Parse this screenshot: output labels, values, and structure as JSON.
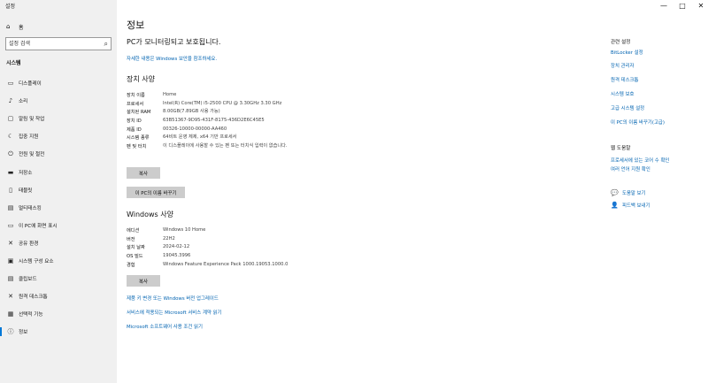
{
  "window": {
    "title": "설정",
    "controls": {
      "minimize": "—",
      "maximize": "□",
      "close": "✕"
    }
  },
  "sidebar": {
    "home": {
      "label": "홈",
      "icon": "home-icon"
    },
    "search": {
      "placeholder": "설정 검색",
      "icon": "search-icon"
    },
    "section": "시스템",
    "items": [
      {
        "label": "디스플레이",
        "icon": "display-icon",
        "glyph": "▭"
      },
      {
        "label": "소리",
        "icon": "speaker-icon",
        "glyph": "♪"
      },
      {
        "label": "알림 및 작업",
        "icon": "notification-icon",
        "glyph": "▢"
      },
      {
        "label": "집중 지원",
        "icon": "moon-icon",
        "glyph": "☾"
      },
      {
        "label": "전원 및 절전",
        "icon": "power-icon",
        "glyph": "⏻"
      },
      {
        "label": "저장소",
        "icon": "storage-icon",
        "glyph": "▬"
      },
      {
        "label": "태블릿",
        "icon": "tablet-icon",
        "glyph": "▯"
      },
      {
        "label": "멀티태스킹",
        "icon": "multitasking-icon",
        "glyph": "▤"
      },
      {
        "label": "이 PC에 화면 표시",
        "icon": "project-icon",
        "glyph": "▭"
      },
      {
        "label": "공유 환경",
        "icon": "share-icon",
        "glyph": "✕"
      },
      {
        "label": "시스템 구성 요소",
        "icon": "components-icon",
        "glyph": "▣"
      },
      {
        "label": "클립보드",
        "icon": "clipboard-icon",
        "glyph": "▤"
      },
      {
        "label": "원격 데스크톱",
        "icon": "remote-desktop-icon",
        "glyph": "✕"
      },
      {
        "label": "선택적 기능",
        "icon": "optional-features-icon",
        "glyph": "▦"
      },
      {
        "label": "정보",
        "icon": "info-icon",
        "glyph": "ⓘ"
      }
    ]
  },
  "main": {
    "title": "정보",
    "protection_status": "PC가 모니터링되고 보호됩니다.",
    "security_link": "자세한 내용은 Windows 보안을 참조하세요.",
    "device_specs": {
      "heading": "장치 사양",
      "rows": [
        {
          "k": "장치 이름",
          "v": "Home"
        },
        {
          "k": "프로세서",
          "v": "Intel(R) Core(TM) i5-2500 CPU @ 3.30GHz   3.30 GHz"
        },
        {
          "k": "설치된 RAM",
          "v": "8.00GB(7.89GB 사용 가능)"
        },
        {
          "k": "장치 ID",
          "v": "63B51367-9D95-431F-8175-436D2E6C45E5"
        },
        {
          "k": "제품 ID",
          "v": "00326-10000-00000-AA460"
        },
        {
          "k": "시스템 종류",
          "v": "64비트 운영 체제, x64 기반 프로세서"
        },
        {
          "k": "펜 및 터치",
          "v": "이 디스플레이에 사용할 수 있는 펜 또는 터치식 입력이 없습니다."
        }
      ],
      "copy_button": "복사",
      "rename_button": "이 PC의 이름 바꾸기"
    },
    "windows_specs": {
      "heading": "Windows 사양",
      "rows": [
        {
          "k": "에디션",
          "v": "Windows 10 Home"
        },
        {
          "k": "버전",
          "v": "22H2"
        },
        {
          "k": "설치 날짜",
          "v": "2024-02-12"
        },
        {
          "k": "OS 빌드",
          "v": "19045.3996"
        },
        {
          "k": "경험",
          "v": "Windows Feature Experience Pack 1000.19053.1000.0"
        }
      ],
      "copy_button": "복사"
    },
    "links": [
      "제품 키 변경 또는 Windows 버전 업그레이드",
      "서비스에 적용되는 Microsoft 서비스 계약 읽기",
      "Microsoft 소프트웨어 사용 조건 읽기"
    ]
  },
  "related": {
    "heading": "관련 설정",
    "links": [
      "BitLocker 설정",
      "장치 관리자",
      "원격 데스크톱",
      "시스템 보호",
      "고급 시스템 설정",
      "이 PC의 이름 바꾸기(고급)"
    ],
    "help_heading": "웹 도움말",
    "help_link": "프로세서에 있는 코어 수 확인",
    "help_link_line2": "여러 언어 지원 확인",
    "get_help": {
      "label": "도움말 보기",
      "icon": "chat-help-icon"
    },
    "feedback": {
      "label": "피드백 보내기",
      "icon": "feedback-icon"
    }
  },
  "colors": {
    "accent": "#0078d7",
    "link": "#0063b1",
    "sidebar": "#f0f0f0",
    "button": "#cccccc"
  }
}
